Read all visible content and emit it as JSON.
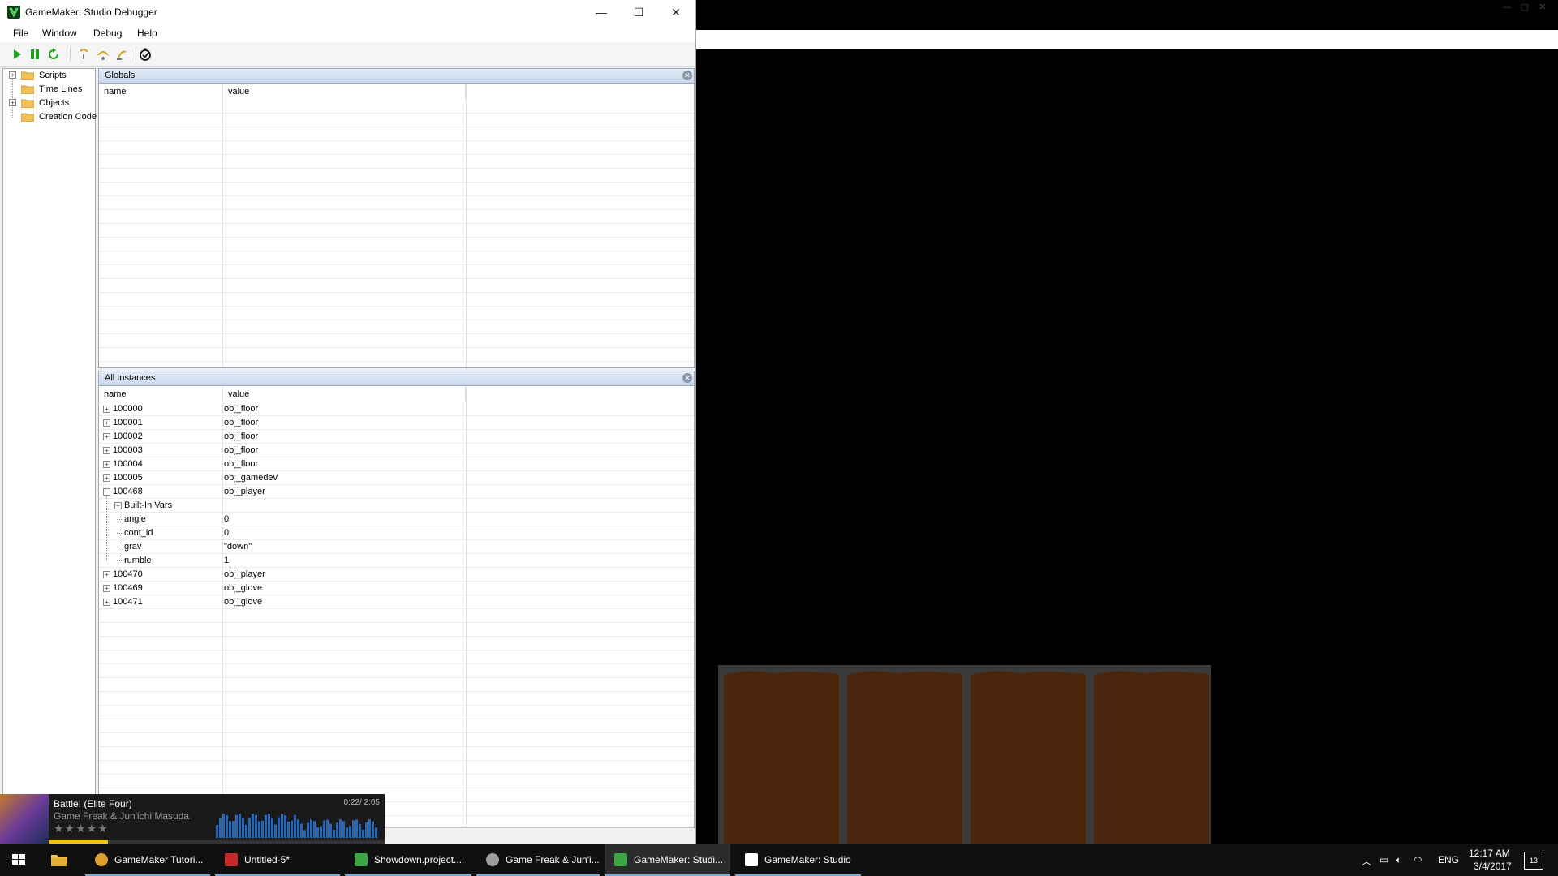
{
  "debugger": {
    "title": "GameMaker: Studio Debugger",
    "controls": {
      "minimize": "—",
      "maximize": "☐",
      "close": "✕"
    },
    "menu": [
      "File",
      "Window",
      "Debug",
      "Help"
    ],
    "toolbar_icons": [
      "run-icon",
      "pause-icon",
      "restart-icon",
      "step-into-icon",
      "step-over-icon",
      "step-out-icon",
      "realtime-icon"
    ],
    "tree": [
      {
        "label": "Scripts",
        "expandable": true
      },
      {
        "label": "Time Lines",
        "expandable": false
      },
      {
        "label": "Objects",
        "expandable": true
      },
      {
        "label": "Creation Code",
        "expandable": false
      }
    ],
    "globals_panel": {
      "title": "Globals",
      "columns": [
        "name",
        "value"
      ]
    },
    "instances_panel": {
      "title": "All Instances",
      "columns": [
        "name",
        "value"
      ],
      "rows": [
        {
          "name": "100000",
          "value": "obj_floor",
          "level": 0,
          "box": "+"
        },
        {
          "name": "100001",
          "value": "obj_floor",
          "level": 0,
          "box": "+"
        },
        {
          "name": "100002",
          "value": "obj_floor",
          "level": 0,
          "box": "+"
        },
        {
          "name": "100003",
          "value": "obj_floor",
          "level": 0,
          "box": "+"
        },
        {
          "name": "100004",
          "value": "obj_floor",
          "level": 0,
          "box": "+"
        },
        {
          "name": "100005",
          "value": "obj_gamedev",
          "level": 0,
          "box": "+"
        },
        {
          "name": "100468",
          "value": "obj_player",
          "level": 0,
          "box": "−"
        },
        {
          "name": "Built-In Vars",
          "value": "",
          "level": 1,
          "box": "+"
        },
        {
          "name": "angle",
          "value": "0",
          "level": 1,
          "box": ""
        },
        {
          "name": "cont_id",
          "value": "0",
          "level": 1,
          "box": ""
        },
        {
          "name": "grav",
          "value": "\"down\"",
          "level": 1,
          "box": ""
        },
        {
          "name": "rumble",
          "value": "1",
          "level": 1,
          "box": ""
        },
        {
          "name": "100470",
          "value": "obj_player",
          "level": 0,
          "box": "+"
        },
        {
          "name": "100469",
          "value": "obj_glove",
          "level": 0,
          "box": "+"
        },
        {
          "name": "100471",
          "value": "obj_glove",
          "level": 0,
          "box": "+"
        }
      ]
    }
  },
  "music_player": {
    "title": "Battle! (Elite Four)",
    "artist": "Game Freak & Jun'ichi Masuda",
    "time": "0:22/ 2:05",
    "rating": "★★★★★",
    "progress": 0.176
  },
  "taskbar": {
    "apps": [
      {
        "icon": "chrome-icon",
        "label": "GameMaker Tutori...",
        "color": "#e0a030"
      },
      {
        "icon": "flash-icon",
        "label": "Untitled-5*",
        "color": "#c62828"
      },
      {
        "icon": "gamemaker-icon",
        "label": "Showdown.project....",
        "color": "#3ca346"
      },
      {
        "icon": "music-player-icon",
        "label": "Game Freak & Jun'i...",
        "color": "#9e9e9e"
      },
      {
        "icon": "gamemaker-icon",
        "label": "GameMaker: Studi...",
        "color": "#3ca346"
      },
      {
        "icon": "gamemaker-icon",
        "label": "GameMaker: Studio",
        "color": "#ffffff"
      }
    ],
    "tray": {
      "lang": "ENG",
      "time": "12:17 AM",
      "date": "3/4/2017",
      "notifications": "13"
    }
  },
  "colors": {
    "accent": "#7aa7d9",
    "floor": "#4a260c",
    "player": "#0a10d8"
  }
}
